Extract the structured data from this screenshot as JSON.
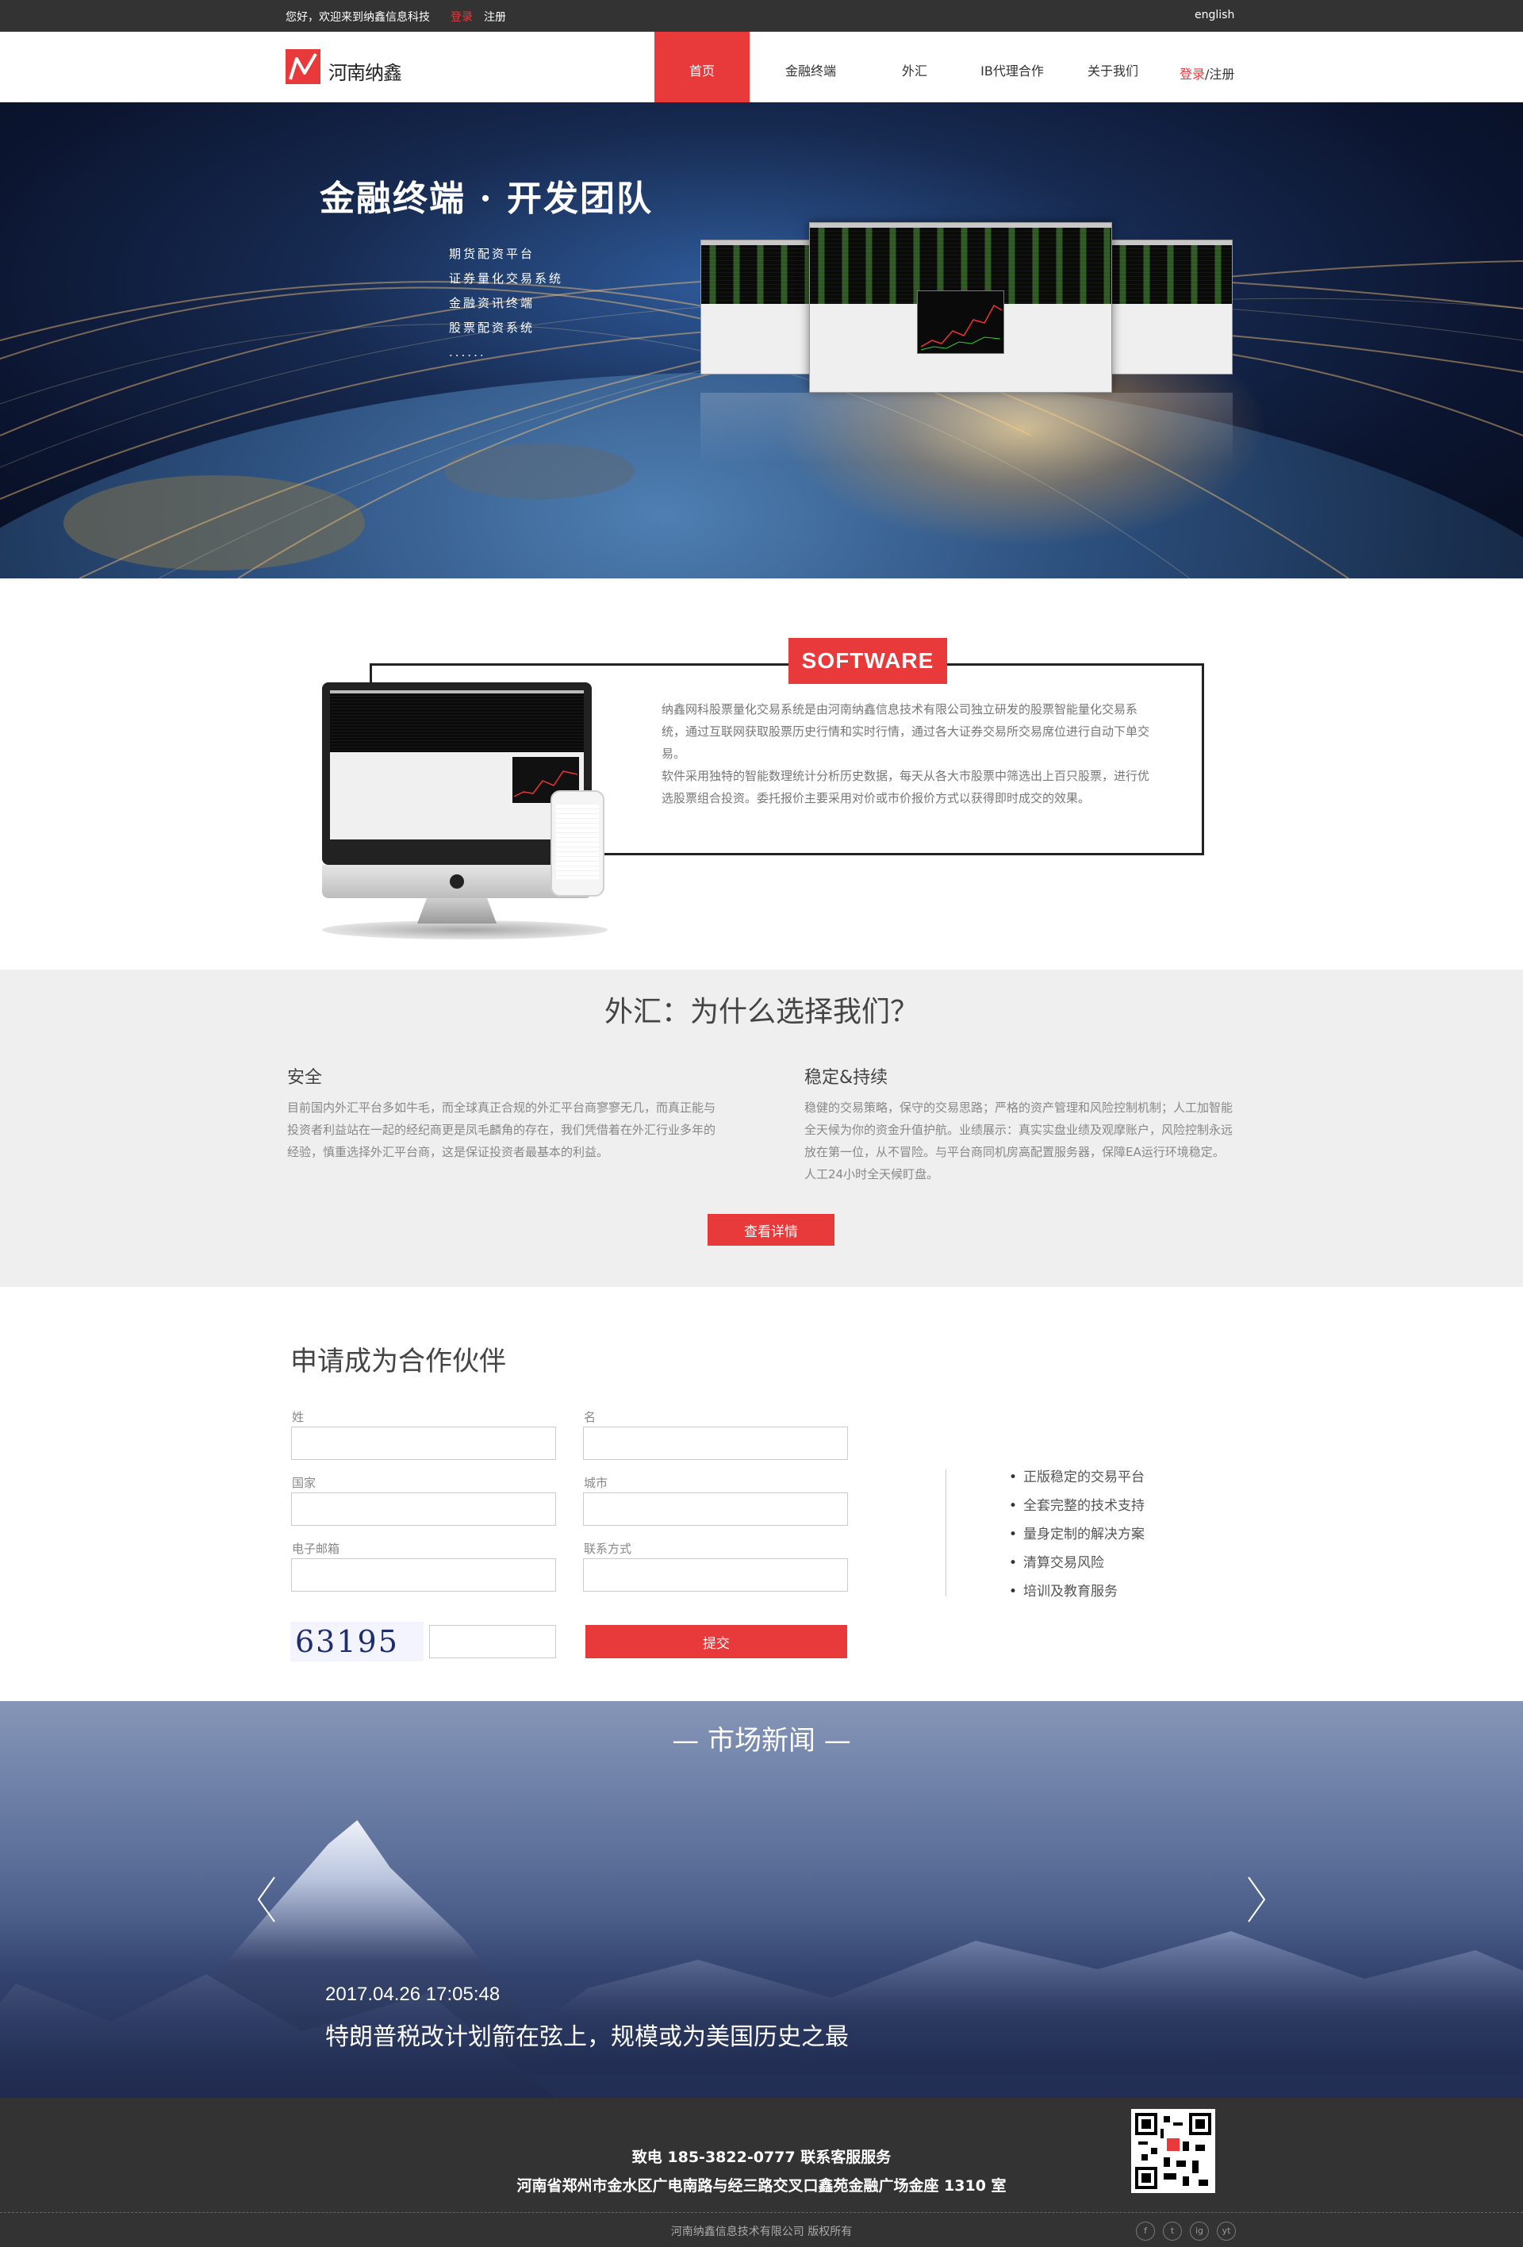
{
  "topbar": {
    "greeting": "您好，欢迎来到纳鑫信息科技",
    "login": "登录",
    "register": "注册",
    "language": "english"
  },
  "header": {
    "logo_text": "河南纳鑫",
    "nav": [
      "首页",
      "金融终端",
      "外汇",
      "IB代理合作",
      "关于我们"
    ],
    "active_index": 0,
    "login": "登录",
    "separator": "/",
    "register": "注册"
  },
  "hero": {
    "title": "金融终端 · 开发团队",
    "items": [
      "期货配资平台",
      "证券量化交易系统",
      "金融资讯终端",
      "股票配资系统",
      "......"
    ]
  },
  "software": {
    "tag": "SOFTWARE",
    "paragraph1": "纳鑫网科股票量化交易系统是由河南纳鑫信息技术有限公司独立研发的股票智能量化交易系统，通过互联网获取股票历史行情和实时行情，通过各大证券交易所交易席位进行自动下单交易。",
    "paragraph2": "软件采用独特的智能数理统计分析历史数据，每天从各大市股票中筛选出上百只股票，进行优选股票组合投资。委托报价主要采用对价或市价报价方式以获得即时成交的效果。"
  },
  "why": {
    "title": "外汇：为什么选择我们？",
    "left": {
      "heading": "安全",
      "text": "目前国内外汇平台多如牛毛，而全球真正合规的外汇平台商寥寥无几，而真正能与投资者利益站在一起的经纪商更是凤毛麟角的存在，我们凭借着在外汇行业多年的经验，慎重选择外汇平台商，这是保证投资者最基本的利益。"
    },
    "right": {
      "heading": "稳定&持续",
      "text": "稳健的交易策略，保守的交易思路；严格的资产管理和风险控制机制；人工加智能全天候为你的资金升值护航。业绩展示：真实实盘业绩及观摩账户，风险控制永远放在第一位，从不冒险。与平台商同机房高配置服务器，保障EA运行环境稳定。人工24小时全天候盯盘。"
    },
    "button": "查看详情"
  },
  "partner": {
    "title": "申请成为合作伙伴",
    "fields": {
      "surname": "姓",
      "name": "名",
      "country": "国家",
      "city": "城市",
      "email": "电子邮箱",
      "contact": "联系方式"
    },
    "captcha": "63195",
    "submit": "提交",
    "benefits": [
      "正版稳定的交易平台",
      "全套完整的技术支持",
      "量身定制的解决方案",
      "清算交易风险",
      "培训及教育服务"
    ]
  },
  "news": {
    "title": "— 市场新闻 —",
    "date": "2017.04.26 17:05:48",
    "headline": "特朗普税改计划箭在弦上，规模或为美国历史之最"
  },
  "footer": {
    "phone": "致电 185-3822-0777 联系客服服务",
    "address": "河南省郑州市金水区广电南路与经三路交叉口鑫苑金融广场金座 1310 室",
    "copyright": "河南纳鑫信息技术有限公司  版权所有",
    "social": [
      "f",
      "t",
      "ig",
      "yt"
    ]
  },
  "colors": {
    "accent": "#e8393b",
    "dark_bar": "#333333",
    "light_section": "#efefef"
  }
}
